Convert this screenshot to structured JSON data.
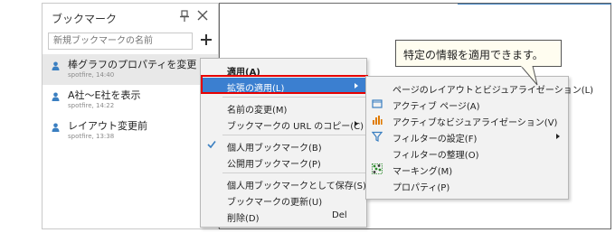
{
  "panel": {
    "title": "ブックマーク",
    "search_placeholder": "新規ブックマークの名前",
    "bookmarks": [
      {
        "name": "棒グラフのプロパティを変更",
        "meta": "spotfire, 14:40"
      },
      {
        "name": "A社～E社を表示",
        "meta": "spotfire, 14:22"
      },
      {
        "name": "レイアウト変更前",
        "meta": "spotfire, 13:38"
      }
    ]
  },
  "context_menu": {
    "items": [
      {
        "label": "適用(A)"
      },
      {
        "label": "拡張の適用(L)"
      },
      {
        "label": "名前の変更(M)"
      },
      {
        "label": "ブックマークの URL のコピー(C)"
      },
      {
        "label": "個人用ブックマーク(B)"
      },
      {
        "label": "公開用ブックマーク(P)"
      },
      {
        "label": "個人用ブックマークとして保存(S)"
      },
      {
        "label": "ブックマークの更新(U)"
      },
      {
        "label": "削除(D)",
        "shortcut": "Del"
      }
    ]
  },
  "submenu": {
    "items": [
      {
        "label": "ページのレイアウトとビジュアライゼーション(L)"
      },
      {
        "label": "アクティブ ページ(A)"
      },
      {
        "label": "アクティブなビジュアライゼーション(V)"
      },
      {
        "label": "フィルターの設定(F)"
      },
      {
        "label": "フィルターの整理(O)"
      },
      {
        "label": "マーキング(M)"
      },
      {
        "label": "プロパティ(P)"
      }
    ]
  },
  "callout": {
    "text": "特定の情報を適用できます。"
  },
  "colors": {
    "highlight": "#3b7fd0",
    "red_frame": "#e60000",
    "icon_blue": "#3a7fc1"
  }
}
